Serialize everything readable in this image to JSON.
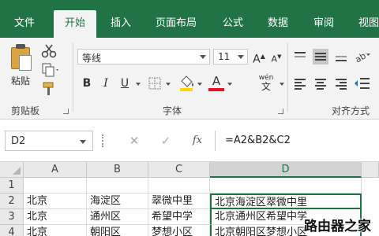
{
  "tabs": [
    "文件",
    "开始",
    "插入",
    "页面布局",
    "公式",
    "数据",
    "审阅",
    "视图"
  ],
  "active_tab": "开始",
  "clipboard": {
    "paste_label": "粘贴",
    "group_label": "剪贴板"
  },
  "font": {
    "name": "等线",
    "size": "11",
    "group_label": "字体",
    "bold": "B",
    "italic": "I",
    "underline": "U",
    "grow": "A",
    "shrink": "A",
    "phonetic": "wén",
    "font_color": "A"
  },
  "alignment": {
    "group_label": "对齐方式"
  },
  "formula_bar": {
    "name_box": "D2",
    "cancel": "✕",
    "enter": "✓",
    "fx": "fx",
    "formula": "=A2&B2&C2"
  },
  "grid": {
    "columns": [
      "A",
      "B",
      "C",
      "D"
    ],
    "selected_column": "D",
    "rows": [
      {
        "num": "1",
        "cells": [
          "",
          "",
          "",
          ""
        ]
      },
      {
        "num": "2",
        "cells": [
          "北京",
          "海淀区",
          "翠微中里",
          "北京海淀区翠微中里"
        ]
      },
      {
        "num": "3",
        "cells": [
          "北京",
          "通州区",
          "希望中学",
          "北京通州区希望中学"
        ]
      },
      {
        "num": "4",
        "cells": [
          "北京",
          "朝阳区",
          "梦想小区",
          "北京朝阳区梦想小区"
        ]
      }
    ]
  },
  "watermark": "路由器之家",
  "colors": {
    "excel_green": "#217346",
    "ribbon_bg": "#f3f3f3"
  }
}
